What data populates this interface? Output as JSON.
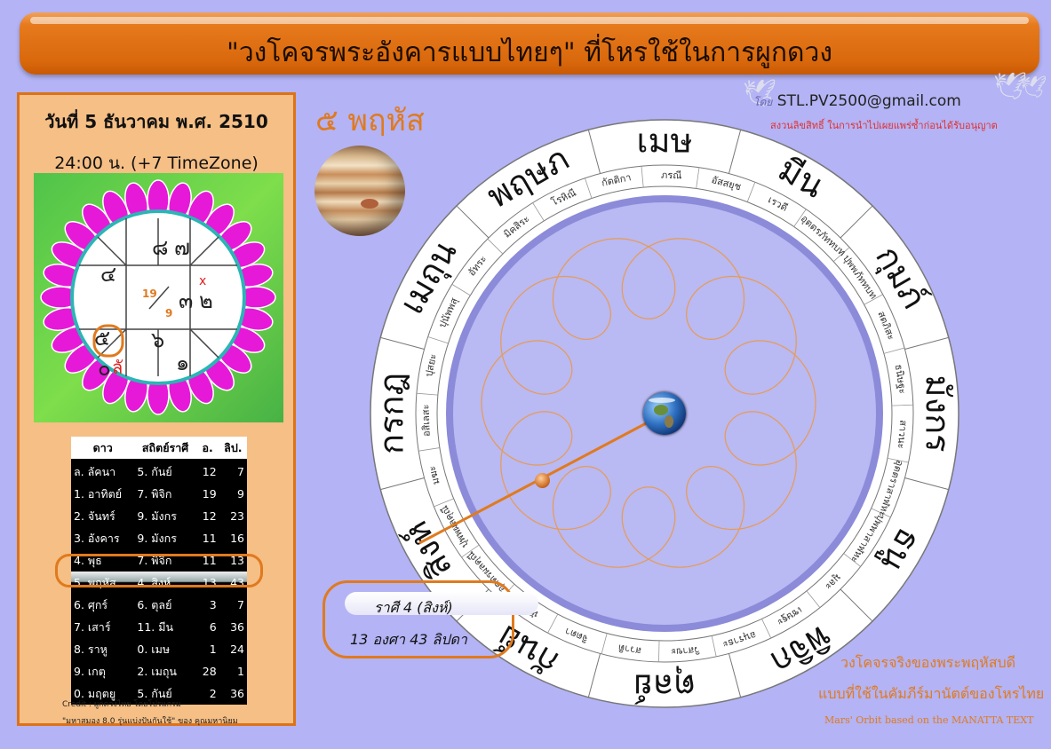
{
  "header": {
    "title": "\"วงโคจรพระอังคารแบบไทยๆ\" ที่โหรใช้ในการผูกดวง"
  },
  "birth": {
    "date": "วันที่ 5 ธันวาคม พ.ศ. 2510",
    "time": "24:00 น. (+7 TimeZone)"
  },
  "horoscope": {
    "center_top": "19",
    "center_bottom": "9",
    "houses": [
      "๘",
      "๗",
      "๔",
      "๓",
      "๒",
      "๙",
      "๖",
      "๑",
      "๕",
      "๐",
      "ลั"
    ],
    "highlight_number": "๔"
  },
  "table": {
    "headers": [
      "ดาว",
      "สถิตย์ราศี",
      "อ.",
      "ลิป."
    ],
    "rows": [
      [
        "ล. ลัคนา",
        "5. กันย์",
        "12",
        "7"
      ],
      [
        "1. อาทิตย์",
        "7. พิจิก",
        "19",
        "9"
      ],
      [
        "2. จันทร์",
        "9. มังกร",
        "12",
        "23"
      ],
      [
        "3. อังคาร",
        "9. มังกร",
        "11",
        "16"
      ],
      [
        "4. พุธ",
        "7. พิจิก",
        "11",
        "13"
      ],
      [
        "5. พฤหัส",
        "4. สิงห์",
        "13",
        "43"
      ],
      [
        "6. ศุกร์",
        "6. ตุลย์",
        "3",
        "7"
      ],
      [
        "7. เสาร์",
        "11. มีน",
        "6",
        "36"
      ],
      [
        "8. ราหู",
        "0. เมษ",
        "1",
        "24"
      ],
      [
        "9. เกตุ",
        "2. เมถุน",
        "28",
        "1"
      ],
      [
        "0. มฤตยู",
        "5. กันย์",
        "2",
        "36"
      ]
    ],
    "highlight_row": 5
  },
  "credits": {
    "line1": "Credit : ผูกดวงไทย โดยโปรแกรม",
    "line2": "\"มหาสมอง 8.0 รุ่นแบ่งปันกันใช้\" ของ คุณมหานิยม"
  },
  "planet": {
    "label": "๕ พฤหัส"
  },
  "author": {
    "prefix": "โดย",
    "email": "STL.PV2500@gmail.com",
    "copyright": "สงวนลิขสิทธิ์ ในการนำไปเผยแพร่ซ้ำก่อนได้รับอนุญาต"
  },
  "position": {
    "rasi": "ราศี 4 (สิงห์)",
    "degree": "13 องศา 43 ลิปดา"
  },
  "zodiac_signs": [
    "เมษ",
    "มีน",
    "กุมภ์",
    "มังกร",
    "ธนู",
    "พิจิก",
    "ตุลย์",
    "กันย์",
    "สิงห์",
    "กรกฎ",
    "เมถุน",
    "พฤษภ"
  ],
  "nakshatras": [
    "อัสสยุช",
    "ภรณี",
    "กัตติกา",
    "โรหิณี",
    "มิคสิระ",
    "อัทระ",
    "ปุนัพพสุ",
    "ปุสยะ",
    "อสิเลสะ",
    "มฆะ",
    "ปุพพผลคุณี",
    "อุตตรผลคุณี",
    "หัตถะ",
    "จิตตา",
    "สวาติ",
    "วิสาขะ",
    "อนุราธะ",
    "เชษฐะ",
    "มูละ",
    "ปุพพาสาฬหะ",
    "อุตตราสาฬหะ",
    "สาวนะ",
    "ธนิษฐะ",
    "สตภิสะ",
    "ปุพพภัททบท",
    "อุตตรภัททบท",
    "เรวดี"
  ],
  "captions": {
    "line1": "วงโคจรจริงของพระพฤหัสบดี",
    "line2": "แบบที่ใช้ในคัมภีร์มานัตต์ของโหรไทย",
    "line3": "Mars' Orbit based on the MANATTA TEXT"
  },
  "colors": {
    "accent": "#e07a1e",
    "background": "#b3b3f5",
    "panel": "#f5bf85",
    "wheel_inner": "#8b8bd9"
  }
}
